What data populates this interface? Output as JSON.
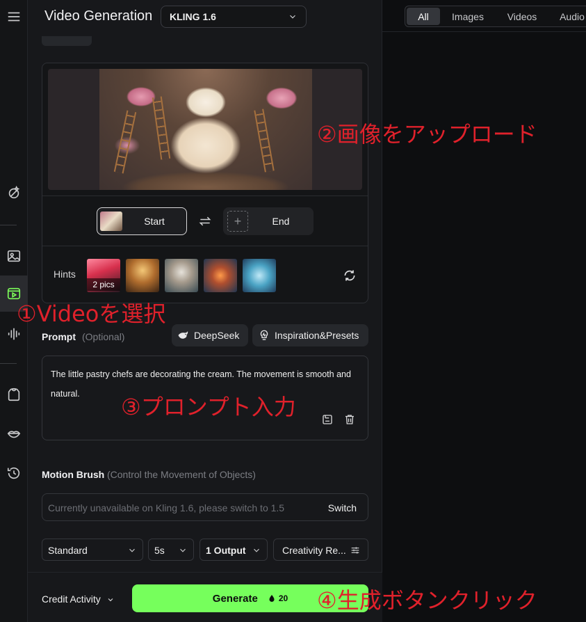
{
  "panel": {
    "title": "Video Generation",
    "model_selected": "KLING 1.6"
  },
  "upload": {
    "start_label": "Start",
    "end_label": "End",
    "hints_label": "Hints",
    "hint_badge": "2 pics"
  },
  "prompt": {
    "label": "Prompt",
    "optional": "(Optional)",
    "deepseek": "DeepSeek",
    "inspiration": "Inspiration&Presets",
    "text": "The little pastry chefs are decorating the cream. The movement is smooth and natural."
  },
  "motion_brush": {
    "label": "Motion Brush",
    "hint": "(Control the Movement of Objects)",
    "placeholder": "Currently unavailable on Kling 1.6, please switch to 1.5",
    "switch": "Switch"
  },
  "options": {
    "mode": "Standard",
    "duration": "5s",
    "outputs": "1 Output",
    "creativity": "Creativity Re..."
  },
  "footer": {
    "credit": "Credit Activity",
    "generate": "Generate",
    "cost": "20"
  },
  "tabs": [
    "All",
    "Images",
    "Videos",
    "Audio"
  ],
  "annotations": {
    "a1": "①Videoを選択",
    "a2": "②画像をアップロード",
    "a3": "③プロンプト入力",
    "a4": "④生成ボタンクリック"
  },
  "colors": {
    "accent": "#76ff5c",
    "annotation": "#e0212b",
    "panel_bg": "#17181b"
  },
  "icons": {
    "menu": "hamburger-icon",
    "magic": "magic-wand-icon",
    "image": "image-icon",
    "video": "video-icon",
    "audio": "audio-wave-icon",
    "avatar": "hoodie-icon",
    "lips": "lips-icon",
    "history": "history-icon"
  }
}
